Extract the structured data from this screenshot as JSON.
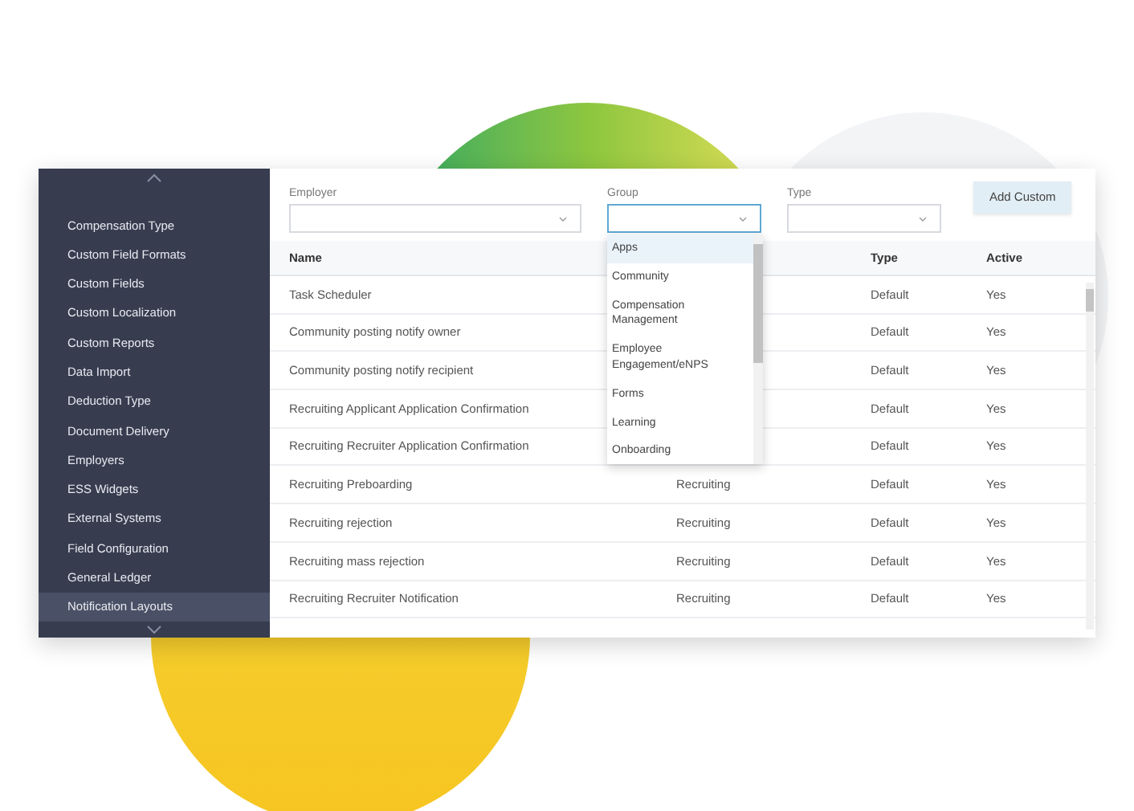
{
  "sidebar": {
    "items": [
      {
        "label": "Compensation Type",
        "selected": false
      },
      {
        "label": "Custom Field Formats",
        "selected": false
      },
      {
        "label": "Custom Fields",
        "selected": false
      },
      {
        "label": "Custom Localization",
        "selected": false
      },
      {
        "label": "Custom Reports",
        "selected": false
      },
      {
        "label": "Data Import",
        "selected": false
      },
      {
        "label": "Deduction Type",
        "selected": false
      },
      {
        "label": "Document Delivery",
        "selected": false
      },
      {
        "label": "Employers",
        "selected": false
      },
      {
        "label": "ESS Widgets",
        "selected": false
      },
      {
        "label": "External Systems",
        "selected": false
      },
      {
        "label": "Field Configuration",
        "selected": false
      },
      {
        "label": "General Ledger",
        "selected": false
      },
      {
        "label": "Notification Layouts",
        "selected": true
      }
    ]
  },
  "filters": [
    {
      "label": "Employer",
      "focused": false
    },
    {
      "label": "Group",
      "focused": true
    },
    {
      "label": "Type",
      "focused": false
    }
  ],
  "add_button": "Add Custom",
  "group_dropdown": {
    "options": [
      {
        "label": "Apps",
        "selected": true
      },
      {
        "label": "Community",
        "selected": false
      },
      {
        "label": "Compensation Management",
        "selected": false
      },
      {
        "label": "Employee Engagement/eNPS",
        "selected": false
      },
      {
        "label": "Forms",
        "selected": false
      },
      {
        "label": "Learning",
        "selected": false
      },
      {
        "label": "Onboarding",
        "selected": false
      }
    ]
  },
  "table": {
    "columns": [
      "Name",
      "Type",
      "Active"
    ],
    "rows": [
      {
        "name": "Task Scheduler",
        "type": "Default",
        "active": "Yes"
      },
      {
        "name": "Community posting notify owner",
        "type": "Default",
        "active": "Yes"
      },
      {
        "name": "Community posting notify recipient",
        "type": "Default",
        "active": "Yes"
      },
      {
        "name": "Recruiting Applicant Application Confirmation",
        "type": "Default",
        "active": "Yes"
      },
      {
        "name": "Recruiting Recruiter Application Confirmation",
        "type": "Default",
        "active": "Yes"
      },
      {
        "name": "Recruiting Preboarding",
        "group": "Recruiting",
        "type": "Default",
        "active": "Yes"
      },
      {
        "name": "Recruiting rejection",
        "group": "Recruiting",
        "type": "Default",
        "active": "Yes"
      },
      {
        "name": "Recruiting mass rejection",
        "group": "Recruiting",
        "type": "Default",
        "active": "Yes"
      },
      {
        "name": "Recruiting Recruiter Notification",
        "group": "Recruiting",
        "type": "Default",
        "active": "Yes"
      }
    ]
  }
}
